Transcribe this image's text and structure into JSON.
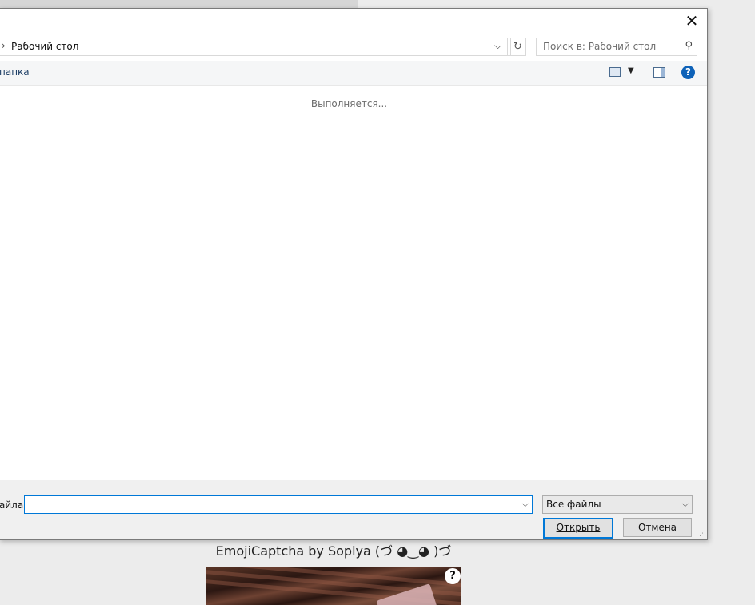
{
  "background": {
    "captcha_title": "EmojiCaptcha by Soplya (づ ◕‿◕ )づ",
    "captcha_help": "?"
  },
  "dialog": {
    "close": "✕",
    "address": {
      "chevron": "›",
      "path": "Рабочий стол",
      "dropdown": "⌵",
      "refresh": "↻"
    },
    "search": {
      "placeholder": "Поиск в: Рабочий стол",
      "icon": "⚲"
    },
    "toolbar": {
      "new_folder": "папка",
      "view_dropdown": "▼",
      "help": "?"
    },
    "content": {
      "status": "Выполняется..."
    },
    "bottom": {
      "filename_label": "айла:",
      "filename_value": "",
      "filename_dropdown": "⌵",
      "filetype_value": "Все файлы",
      "filetype_dropdown": "⌵",
      "open_label": "Открыть",
      "cancel_label": "Отмена",
      "resize_grip": "⋰"
    }
  },
  "colors": {
    "accent": "#0078d7",
    "help_blue": "#0e62b8",
    "link_text": "#1e3f66",
    "toolbar_bg": "#f5f6f7",
    "footer_bg": "#f0f0f0"
  }
}
